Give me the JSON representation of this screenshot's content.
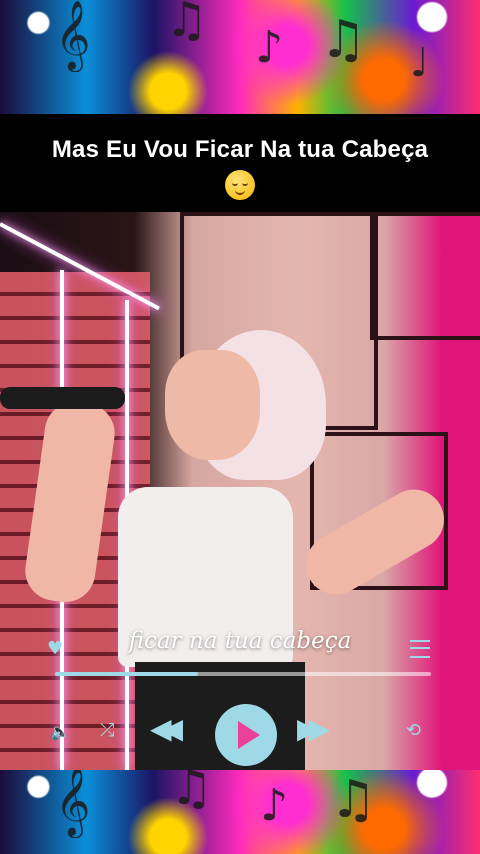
{
  "caption": {
    "text": "Mas Eu Vou Ficar Na tua Cabeça",
    "emoji": "relieved-face"
  },
  "lyric": "ficar na tua cabeça",
  "player": {
    "progress": 0.38,
    "accent_color": "#9fd9e7",
    "play_color": "#ea3f9a",
    "icons": [
      "heart-icon",
      "menu-icon",
      "volume-icon",
      "shuffle-icon",
      "previous-icon",
      "play-icon",
      "next-icon",
      "repeat-icon"
    ]
  }
}
